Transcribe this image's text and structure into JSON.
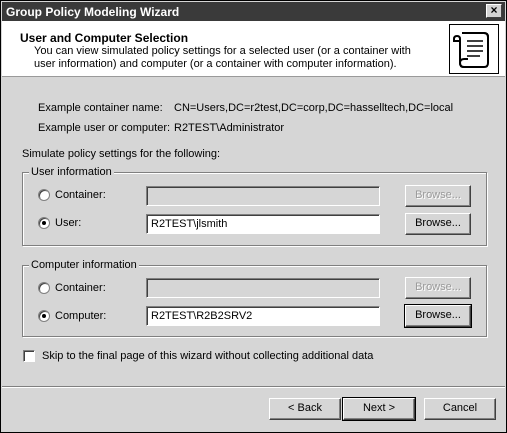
{
  "window": {
    "title": "Group Policy Modeling Wizard",
    "close_label": "×"
  },
  "header": {
    "title": "User and Computer Selection",
    "description": "You can view simulated policy settings for a selected user (or a container with user information) and computer (or a container with computer information)."
  },
  "example": {
    "container_label": "Example container name:",
    "container_value": "CN=Users,DC=r2test,DC=corp,DC=hasselltech,DC=local",
    "user_label": "Example user or computer:",
    "user_value": "R2TEST\\Administrator"
  },
  "simulate_label": "Simulate policy settings for the following:",
  "user_info": {
    "legend": "User information",
    "container_label": "Container:",
    "container_value": "",
    "container_browse": "Browse...",
    "user_label": "User:",
    "user_value": "R2TEST\\jlsmith",
    "user_browse": "Browse...",
    "selected": "user"
  },
  "computer_info": {
    "legend": "Computer information",
    "container_label": "Container:",
    "container_value": "",
    "container_browse": "Browse...",
    "computer_label": "Computer:",
    "computer_value": "R2TEST\\R2B2SRV2",
    "computer_browse": "Browse...",
    "selected": "computer"
  },
  "skip_checkbox": {
    "label": "Skip to the final page of this wizard without collecting additional data",
    "checked": false
  },
  "footer": {
    "back": "< Back",
    "next": "Next >",
    "cancel": "Cancel"
  }
}
